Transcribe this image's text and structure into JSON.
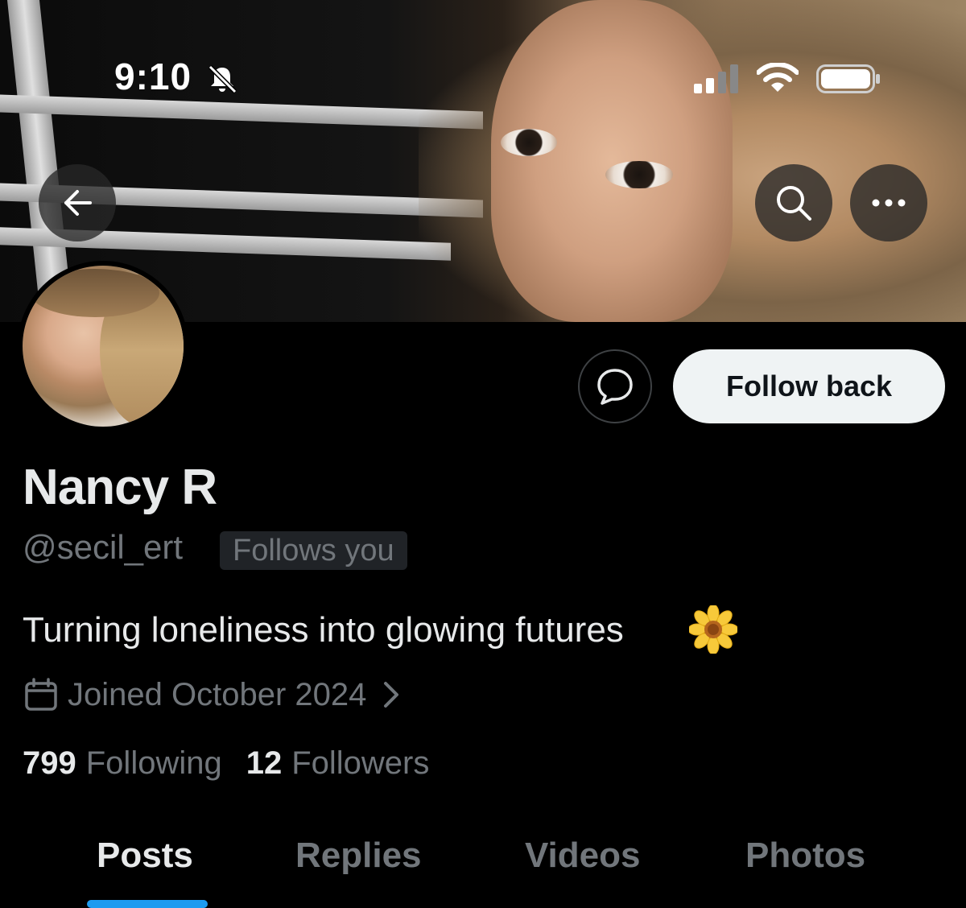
{
  "status_bar": {
    "time": "9:10",
    "icons": [
      "bell-slash-icon",
      "cellular-signal-icon",
      "wifi-icon",
      "battery-icon"
    ]
  },
  "header": {
    "back_icon": "arrow-left-icon",
    "search_icon": "search-icon",
    "more_icon": "more-horizontal-icon"
  },
  "profile": {
    "name": "Nancy R",
    "handle": "@secil_ert",
    "follows_you_badge": "Follows you",
    "bio": "Turning loneliness into glowing futures",
    "bio_emoji": "sunflower-emoji",
    "joined": "Joined October 2024",
    "following_count": "799",
    "following_label": "Following",
    "followers_count": "12",
    "followers_label": "Followers"
  },
  "actions": {
    "message_icon": "message-bubble-icon",
    "follow_back_label": "Follow back"
  },
  "tabs": [
    {
      "label": "Posts",
      "active": true
    },
    {
      "label": "Replies",
      "active": false
    },
    {
      "label": "Videos",
      "active": false
    },
    {
      "label": "Photos",
      "active": false
    }
  ],
  "colors": {
    "background": "#000000",
    "primary_text": "#e7e9ea",
    "secondary_text": "#71767b",
    "accent": "#1d9bf0",
    "follow_button_bg": "#eff3f4"
  }
}
